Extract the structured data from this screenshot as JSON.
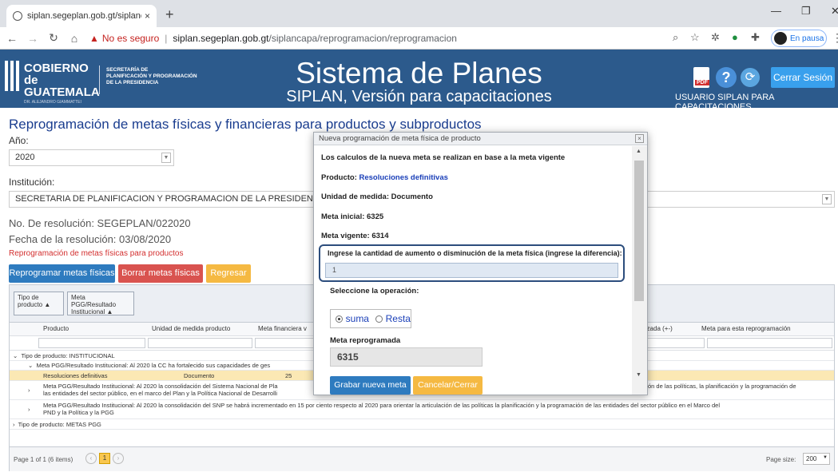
{
  "browser": {
    "tab_title": "siplan.segeplan.gob.gt/siplancapa",
    "tab_close": "×",
    "new_tab": "+",
    "security_warning": "No es seguro",
    "url_host": "siplan.segeplan.gob.gt",
    "url_path": "/siplancapa/reprogramacion/reprogramacion",
    "profile_status": "En pausa"
  },
  "header": {
    "logo_line1": "COBIERNO de",
    "logo_line2": "GUATEMALA",
    "logo_line3": "DR. ALEJANDRO GIAMMATTEI",
    "secretaria_l1": "SECRETARÍA DE",
    "secretaria_l2": "PLANIFICACIÓN Y PROGRAMACIÓN",
    "secretaria_l3": "DE LA PRESIDENCIA",
    "title": "Sistema de Planes",
    "subtitle": "SIPLAN, Versión para capacitaciones",
    "pdf_label": "PDF",
    "logout_label": "Cerrar Sesión",
    "user_label": "USUARIO SIPLAN PARA CAPACITACIONES"
  },
  "page": {
    "title": "Reprogramación de metas físicas y financieras para productos y subproductos",
    "year_label": "Año:",
    "year_value": "2020",
    "institution_label": "Institución:",
    "institution_value": "SECRETARIA DE PLANIFICACION Y PROGRAMACION DE LA PRESIDENCIA SEGEPLAN",
    "resolution_number": "No. De resolución: SEGEPLAN/022020",
    "resolution_date": "Fecha de la resolución: 03/08/2020",
    "reprog_link": "Reprogramación de metas físicas para productos",
    "btn_reprogramar": "Reprogramar metas físicas",
    "btn_borrar": "Borrar metas físicas",
    "btn_regresar": "Regresar"
  },
  "grid": {
    "group_chips": [
      "Tipo de producto",
      "Meta PGG/Resultado Institucional"
    ],
    "columns": [
      "Producto",
      "Unidad de medida producto",
      "Meta financiera v",
      "lizada (+-)",
      "Meta para esta reprogramación"
    ],
    "rows": [
      {
        "text": "Tipo de producto: INSTITUCIONAL"
      },
      {
        "text": "Meta PGG/Resultado Institucional: Al 2020 la CC ha fortalecido sus capacidades de ges"
      },
      {
        "producto": "Resoluciones definitivas",
        "unidad": "Documento",
        "meta": "25"
      },
      {
        "text": "Meta PGG/Resultado Institucional: Al 2020 la consolidación del Sistema Nacional de Pla",
        "text2": "las entidades del sector público, en el marco del Plan y la Política Nacional de Desarrolli",
        "tail": "ón de las políticas, la planificación y la programación de"
      },
      {
        "text": "Meta PGG/Resultado Institucional: Al 2020 la consolidación del SNP se habrá incrementado en 15 por ciento respecto al 2020 para orientar la articulación de las políticas la planificación y la programación de las entidades del sector público en el Marco del",
        "text2": "PND y la Política y la PGG"
      },
      {
        "text": "Tipo de producto: METAS PGG"
      }
    ],
    "pager_text": "Page 1 of 1 (6 items)",
    "pager_current": "1",
    "page_size_label": "Page size:",
    "page_size_value": "200"
  },
  "dialog": {
    "title": "Nueva programación de meta física de producto",
    "close": "×",
    "note": "Los calculos de la nueva meta se realizan en base a la meta vigente",
    "product_label": "Producto:",
    "product_value": "Resoluciones definitivas",
    "unit": "Unidad de medida: Documento",
    "meta_inicial": "Meta inicial: 6325",
    "meta_vigente": "Meta vigente: 6314",
    "input_label": "Ingrese la cantidad de aumento o disminución de la meta física (ingrese la diferencia):",
    "input_value": "1",
    "operation_label": "Seleccione la operación:",
    "op_suma": "suma",
    "op_resta": "Resta",
    "result_label": "Meta reprogramada",
    "result_value": "6315",
    "btn_save": "Grabar nueva meta",
    "btn_cancel": "Cancelar/Cerrar"
  },
  "colors": {
    "header_bg": "#2c5a8c",
    "title_blue": "#1a3d8f",
    "btn_blue": "#2e7bbf",
    "btn_red": "#d9534f",
    "btn_orange": "#f5b942",
    "row_highlight": "#fbe8b4"
  }
}
